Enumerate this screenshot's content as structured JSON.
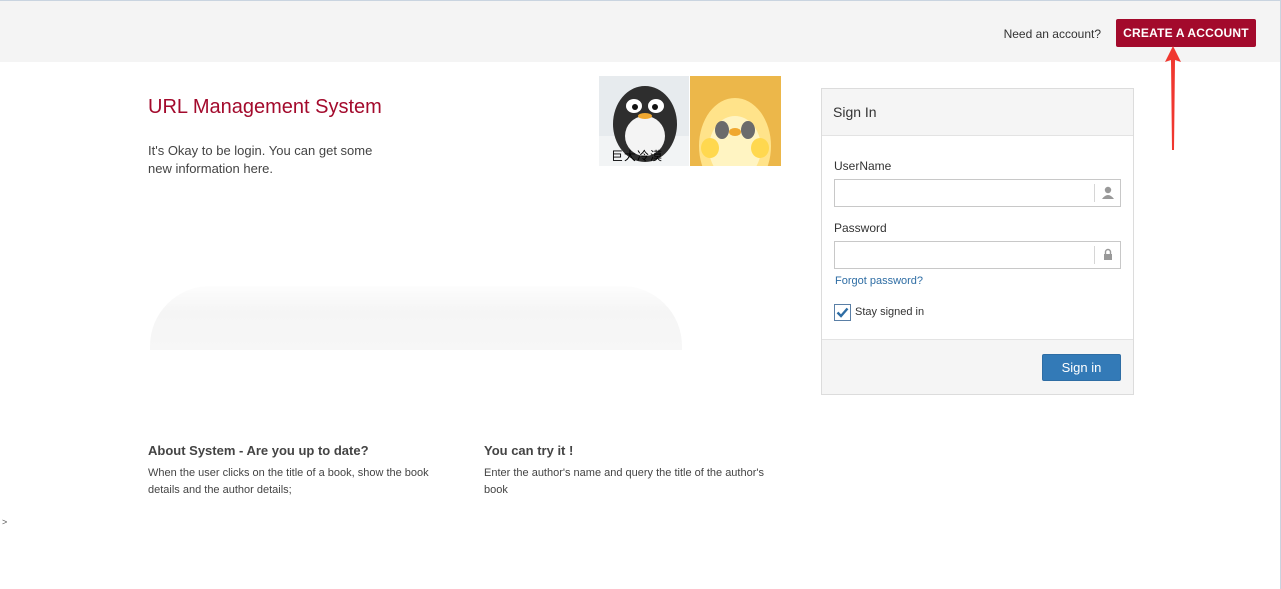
{
  "header": {
    "need_account_text": "Need an account?",
    "create_account_label": "CREATE A ACCOUNT",
    "accent_color": "#a30a2c"
  },
  "intro": {
    "title": "URL Management System",
    "description": "It's Okay to be login. You can get some new information here."
  },
  "sticker": {
    "caption": "巨大冷漠"
  },
  "signin": {
    "heading": "Sign In",
    "username_label": "UserName",
    "username_value": "",
    "username_icon": "user-icon",
    "password_label": "Password",
    "password_value": "",
    "password_icon": "lock-icon",
    "forgot_label": "Forgot password?",
    "stay_signed_label": "Stay signed in",
    "stay_signed_checked": true,
    "submit_label": "Sign in"
  },
  "info": {
    "about_title": "About System - Are you up to date?",
    "about_body": "When the user clicks on the title of a book, show the book details and the author details;",
    "try_title": "You can try it !",
    "try_body": "Enter the author's name and query the title of the author's book"
  },
  "stray_text": ">"
}
